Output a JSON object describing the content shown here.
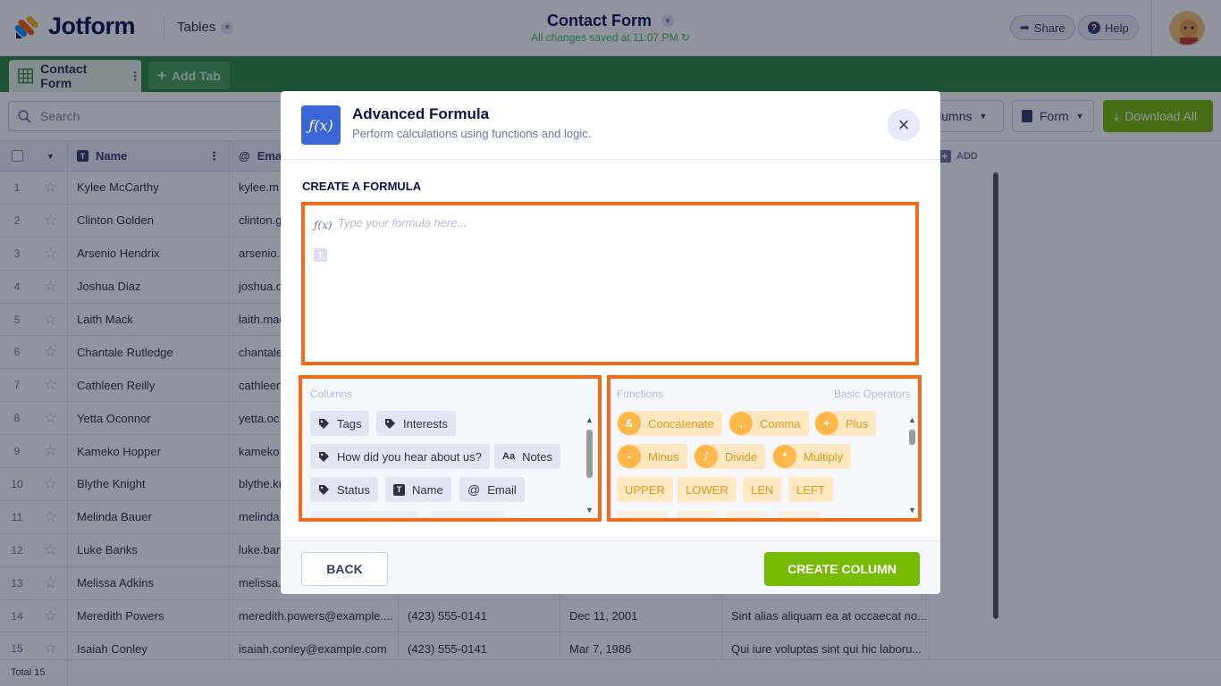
{
  "app": {
    "brand": "Jotform",
    "section_dropdown": "Tables"
  },
  "document": {
    "title": "Contact Form",
    "save_status": "All changes saved at 11:07 PM"
  },
  "header_actions": {
    "share_label": "Share",
    "help_label": "Help"
  },
  "tabs": [
    {
      "label": "Contact Form"
    }
  ],
  "add_tab_label": "Add Tab",
  "toolbar": {
    "search_placeholder": "Search",
    "columns_label": "Columns",
    "form_label": "Form",
    "download_all_label": "Download All"
  },
  "table": {
    "headers": {
      "name": "Name",
      "email": "Ema",
      "add_column": "ADD"
    },
    "rows": [
      {
        "num": "1",
        "name": "Kylee McCarthy",
        "email": "kylee.m",
        "phone": "",
        "date": "",
        "text": ""
      },
      {
        "num": "2",
        "name": "Clinton Golden",
        "email": "clinton.g",
        "phone": "",
        "date": "",
        "text": ""
      },
      {
        "num": "3",
        "name": "Arsenio Hendrix",
        "email": "arsenio.h",
        "phone": "",
        "date": "",
        "text": ""
      },
      {
        "num": "4",
        "name": "Joshua Diaz",
        "email": "joshua.d",
        "phone": "",
        "date": "",
        "text": ""
      },
      {
        "num": "5",
        "name": "Laith Mack",
        "email": "laith.mac",
        "phone": "",
        "date": "",
        "text": ""
      },
      {
        "num": "6",
        "name": "Chantale Rutledge",
        "email": "chantale",
        "phone": "",
        "date": "",
        "text": ""
      },
      {
        "num": "7",
        "name": "Cathleen Reilly",
        "email": "cathleen",
        "phone": "",
        "date": "",
        "text": ""
      },
      {
        "num": "8",
        "name": "Yetta Oconnor",
        "email": "yetta.oc",
        "phone": "",
        "date": "",
        "text": ""
      },
      {
        "num": "9",
        "name": "Kameko Hopper",
        "email": "kameko.",
        "phone": "",
        "date": "",
        "text": ""
      },
      {
        "num": "10",
        "name": "Blythe Knight",
        "email": "blythe.kr",
        "phone": "",
        "date": "",
        "text": ""
      },
      {
        "num": "11",
        "name": "Melinda Bauer",
        "email": "melinda.",
        "phone": "",
        "date": "",
        "text": ""
      },
      {
        "num": "12",
        "name": "Luke Banks",
        "email": "luke.ban",
        "phone": "",
        "date": "",
        "text": ""
      },
      {
        "num": "13",
        "name": "Melissa Adkins",
        "email": "melissa.a",
        "phone": "",
        "date": "",
        "text": ""
      },
      {
        "num": "14",
        "name": "Meredith Powers",
        "email": "meredith.powers@example....",
        "phone": "(423) 555-0141",
        "date": "Dec 11, 2001",
        "text": "Sint alias aliquam ea at occaecat no..."
      },
      {
        "num": "15",
        "name": "Isaiah Conley",
        "email": "isaiah.conley@example.com",
        "phone": "(423) 555-0141",
        "date": "Mar 7, 1986",
        "text": "Qui iure voluptas sint qui hic laboru..."
      }
    ],
    "total_label": "Total 15"
  },
  "modal": {
    "title": "Advanced Formula",
    "subtitle": "Perform calculations using functions and logic.",
    "create_label": "CREATE A FORMULA",
    "formula_placeholder": "Type your formula here...",
    "columns_header": "Columns",
    "functions_header": "Functions",
    "operators_header": "Basic Operators",
    "column_chips": [
      {
        "label": "Tags",
        "icon": "tag-icon"
      },
      {
        "label": "Interests",
        "icon": "tag-icon"
      },
      {
        "label": "How did you hear about us?",
        "icon": "tag-icon"
      },
      {
        "label": "Notes",
        "icon": "text-aa-icon"
      },
      {
        "label": "Status",
        "icon": "tag-icon"
      },
      {
        "label": "Name",
        "icon": "text-t-icon"
      },
      {
        "label": "Email",
        "icon": "at-icon"
      }
    ],
    "operator_chips": [
      {
        "symbol": "&",
        "label": "Concatenate"
      },
      {
        "symbol": ",",
        "label": "Comma"
      },
      {
        "symbol": "+",
        "label": "Plus"
      },
      {
        "symbol": "-",
        "label": "Minus"
      },
      {
        "symbol": "/",
        "label": "Divide"
      },
      {
        "symbol": "*",
        "label": "Multiply"
      }
    ],
    "function_chips": [
      "UPPER",
      "LOWER",
      "LEN",
      "LEFT"
    ],
    "back_label": "BACK",
    "create_column_label": "CREATE COLUMN"
  },
  "colors": {
    "brand_green": "#2d8b3e",
    "accent_green": "#78bb07",
    "highlight_orange": "#f26a1b",
    "formula_blue": "#3a66d6"
  }
}
